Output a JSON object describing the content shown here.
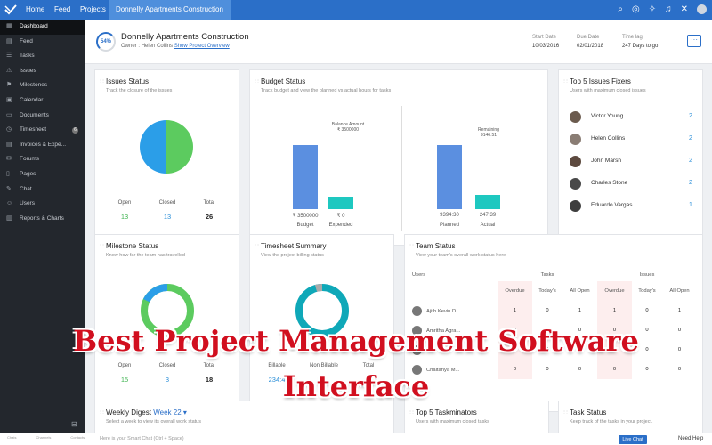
{
  "topnav": {
    "items": [
      "Home",
      "Feed",
      "Projects"
    ],
    "active": "Donnelly Apartments Construction",
    "icons": [
      "search-icon",
      "gamepad-icon",
      "bulb-icon",
      "bell-icon",
      "tools-icon",
      "avatar-icon"
    ]
  },
  "sidebar": {
    "items": [
      {
        "label": "Dashboard",
        "icon": "dashboard-icon"
      },
      {
        "label": "Feed",
        "icon": "feed-icon"
      },
      {
        "label": "Tasks",
        "icon": "tasks-icon"
      },
      {
        "label": "Issues",
        "icon": "issues-icon"
      },
      {
        "label": "Milestones",
        "icon": "milestones-icon"
      },
      {
        "label": "Calendar",
        "icon": "calendar-icon"
      },
      {
        "label": "Documents",
        "icon": "documents-icon"
      },
      {
        "label": "Timesheet",
        "icon": "timesheet-icon",
        "badge": "6"
      },
      {
        "label": "Invoices & Expe...",
        "icon": "invoice-icon"
      },
      {
        "label": "Forums",
        "icon": "forums-icon"
      },
      {
        "label": "Pages",
        "icon": "pages-icon"
      },
      {
        "label": "Chat",
        "icon": "chat-icon"
      },
      {
        "label": "Users",
        "icon": "users-icon"
      },
      {
        "label": "Reports & Charts",
        "icon": "reports-icon"
      }
    ],
    "bottom": [
      "Chats",
      "Channels",
      "Contacts"
    ]
  },
  "header": {
    "progress": "54%",
    "title": "Donnelly Apartments Construction",
    "owner_label": "Owner :",
    "owner": "Helen Collins",
    "overview_link": "Show Project Overview",
    "start_label": "Start Date",
    "start": "10/03/2016",
    "due_label": "Due Date",
    "due": "02/01/2018",
    "lag_label": "Time lag",
    "lag": "247 Days to go",
    "more": "···"
  },
  "issues_status": {
    "title": "Issues Status",
    "subtitle": "Track the closure of the issues",
    "open_label": "Open",
    "closed_label": "Closed",
    "total_label": "Total",
    "open": "13",
    "closed": "13",
    "total": "26",
    "colors": {
      "open": "#5ccb5f",
      "closed": "#2b9ee8"
    }
  },
  "budget_status": {
    "title": "Budget Status",
    "subtitle": "Track budget and view the planned vs actual hours for tasks",
    "left_annot": "Balance Amount\n₹ 3500000",
    "right_annot": "Remaining\n9146:51",
    "bars": [
      {
        "value": "₹ 3500000",
        "label": "Budget",
        "fraction": 0.9
      },
      {
        "value": "₹ 0",
        "label": "Expended",
        "fraction": 0.18
      },
      {
        "value": "9394:30",
        "label": "Planned",
        "fraction": 0.9
      },
      {
        "value": "247:39",
        "label": "Actual",
        "fraction": 0.2
      }
    ],
    "colors": {
      "primary": "#5b8fe0",
      "secondary": "#1ec8c0"
    }
  },
  "fixers": {
    "title": "Top 5 Issues Fixers",
    "subtitle": "Users with maximum closed issues",
    "people": [
      {
        "name": "Victor Young",
        "count": "2"
      },
      {
        "name": "Helen Collins",
        "count": "2"
      },
      {
        "name": "John Marsh",
        "count": "2"
      },
      {
        "name": "Charles Stone",
        "count": "2"
      },
      {
        "name": "Eduardo Vargas",
        "count": "1"
      }
    ]
  },
  "milestone_status": {
    "title": "Milestone Status",
    "subtitle": "Know how far the team has travelled",
    "open_label": "Open",
    "closed_label": "Closed",
    "total_label": "Total",
    "open": "15",
    "closed": "3",
    "total": "18"
  },
  "timesheet_summary": {
    "title": "Timesheet Summary",
    "subtitle": "View the project billing status",
    "billable_label": "Billable",
    "nonbillable_label": "Non Billable",
    "total_label": "Total",
    "billable": "234:4",
    "nonbillable": "",
    "total": ""
  },
  "team_status": {
    "title": "Team Status",
    "subtitle": "View your team's overall work status here",
    "users_label": "Users",
    "tasks_label": "Tasks",
    "issues_label": "Issues",
    "subheads": [
      "Overdue",
      "Today's",
      "All Open",
      "Overdue",
      "Today's",
      "All Open"
    ],
    "rows": [
      {
        "name": "Ajith Kevin D...",
        "values": [
          "1",
          "0",
          "1",
          "1",
          "0",
          "1"
        ]
      },
      {
        "name": "Amritha Agra...",
        "values": [
          "0",
          "0",
          "0",
          "0",
          "0",
          "0"
        ]
      },
      {
        "name": "",
        "values": [
          "0",
          "0",
          "0",
          "0",
          "0",
          "0"
        ]
      },
      {
        "name": "Chaitanya M...",
        "values": [
          "0",
          "0",
          "0",
          "0",
          "0",
          "0"
        ]
      }
    ]
  },
  "weekly_digest": {
    "title": "Weekly Digest",
    "week": "Week 22 ▾",
    "subtitle": "Select a week to view its overall work status"
  },
  "taskminators": {
    "title": "Top 5 Taskminators",
    "subtitle": "Users with maximum closed tasks"
  },
  "task_status": {
    "title": "Task Status",
    "subtitle": "Keep track of the tasks in your project."
  },
  "overlay": {
    "line1": "Best Project Management Software",
    "line2": "Interface"
  },
  "bottombar": {
    "placeholder": "Here is your Smart Chat (Ctrl + Space)",
    "live_chat": "Live Chat",
    "help": "Need Help"
  }
}
